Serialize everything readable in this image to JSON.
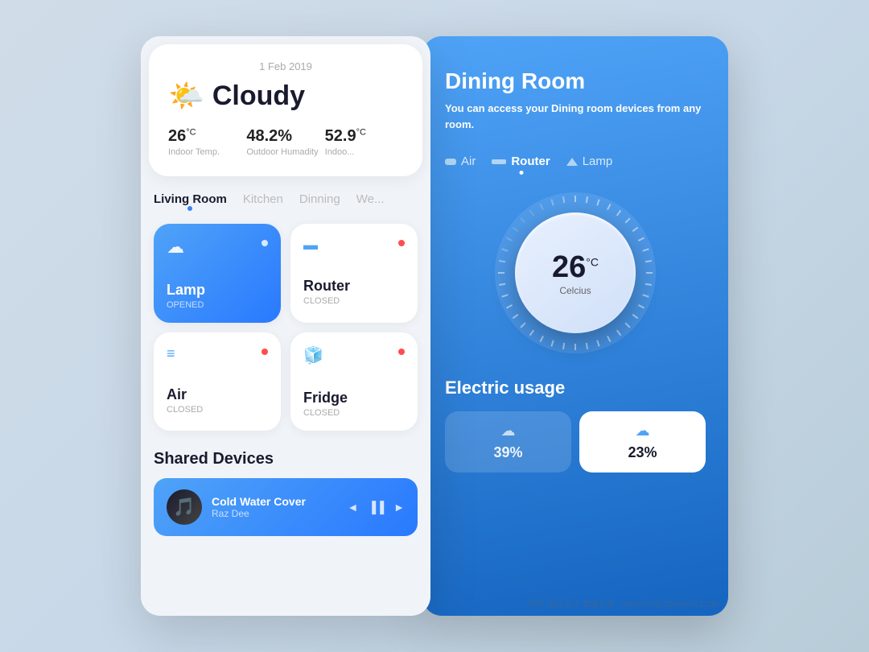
{
  "left": {
    "weather": {
      "date": "1 Feb 2019",
      "condition": "Cloudy",
      "stats": [
        {
          "value": "26",
          "unit": "°C",
          "label": "Indoor Temp."
        },
        {
          "value": "48.2%",
          "label": "Outdoor Humadity"
        },
        {
          "value": "52.9",
          "unit": "°C",
          "label": "Indoo..."
        }
      ]
    },
    "room_tabs": [
      "Living Room",
      "Kitchen",
      "Dinning",
      "We..."
    ],
    "devices": [
      {
        "name": "Lamp",
        "status": "OPENED",
        "active": true,
        "dot": "on-white",
        "icon": "☁"
      },
      {
        "name": "Router",
        "status": "CLOSED",
        "active": false,
        "dot": "off",
        "icon": "📡"
      },
      {
        "name": "Air",
        "status": "CLOSED",
        "active": false,
        "dot": "off",
        "icon": "❄"
      },
      {
        "name": "Fridge",
        "status": "CLOSED",
        "active": false,
        "dot": "off",
        "icon": "🧊"
      }
    ],
    "shared": {
      "title": "Shared Devices",
      "track_name": "Cold Water Cover",
      "artist": "Raz Dee",
      "controls": [
        "◄",
        "▐▐",
        "►"
      ]
    }
  },
  "right": {
    "room_title": "Dining Room",
    "room_desc_part1": "You can access your Dining room devices from any ",
    "room_desc_highlight": "room",
    "room_desc_end": ".",
    "filters": [
      {
        "name": "Air",
        "type": "air",
        "active": false
      },
      {
        "name": "Router",
        "type": "router",
        "active": true
      },
      {
        "name": "Lamp",
        "type": "lamp",
        "active": false
      }
    ],
    "dial": {
      "value": "26",
      "unit": "°C",
      "label": "Celcius"
    },
    "electric_title": "Electric usage",
    "electric_cards": [
      {
        "pct": "39%",
        "white": false
      },
      {
        "pct": "23%",
        "white": true
      }
    ]
  }
}
